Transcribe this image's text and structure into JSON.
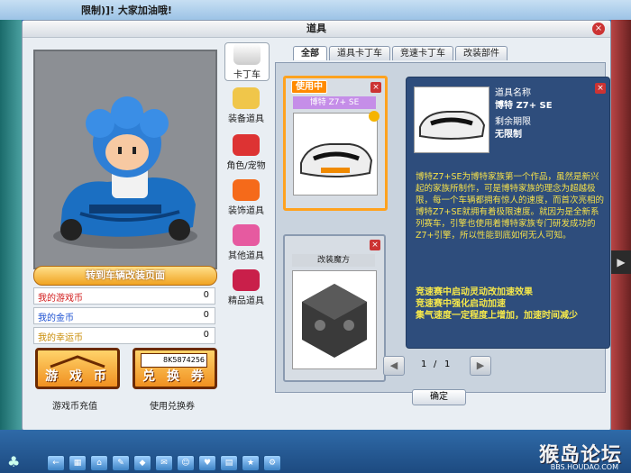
{
  "top_marquee": "限制)]! 大家加油哦!",
  "dialog": {
    "title": "道具",
    "close_label": "×"
  },
  "left_panel": {
    "switch_label": "转到车辆改装页面",
    "currencies": [
      {
        "label": "我的游戏币",
        "value": "0",
        "color": "#d11a1a"
      },
      {
        "label": "我的金币",
        "value": "0",
        "color": "#1a4fd1"
      },
      {
        "label": "我的幸运币",
        "value": "0",
        "color": "#c88a00"
      }
    ],
    "buttons": [
      {
        "label": "游 戏 币",
        "caption": "游戏币充值"
      },
      {
        "label": "兑 换 券",
        "caption": "使用兑换券",
        "barcode": "8K5874256"
      }
    ]
  },
  "categories": [
    {
      "label": "卡丁车",
      "selected": true
    },
    {
      "label": "装备道具",
      "selected": false
    },
    {
      "label": "角色/宠物",
      "selected": false
    },
    {
      "label": "装饰道具",
      "selected": false
    },
    {
      "label": "其他道具",
      "selected": false
    },
    {
      "label": "精品道具",
      "selected": false
    }
  ],
  "tabs": [
    {
      "label": "全部",
      "active": true
    },
    {
      "label": "道具卡丁车",
      "active": false
    },
    {
      "label": "竞速卡丁车",
      "active": false
    },
    {
      "label": "改装部件",
      "active": false
    }
  ],
  "items": [
    {
      "name": "博特 Z7+ SE",
      "badge": "使用中",
      "close": "×"
    },
    {
      "name": "改装魔方",
      "close": "×"
    }
  ],
  "detail": {
    "name_label": "道具名称",
    "name_value": "博特 Z7+ SE",
    "expire_label": "剩余期限",
    "expire_value": "无限制",
    "close": "×",
    "description": "博特Z7+SE为博特家族第一个作品，虽然是新兴起的家族所制作，可是博特家族的理念为超越极限，每一个车辆都拥有惊人的速度，而首次亮相的博特Z7+SE就拥有着极限速度。就因为是全新系列赛车，引擎也使用着博特家族专门研发成功的Z7+引擎，所以性能到底如何无人可知。",
    "features": [
      "竞速赛中启动灵动改加速效果",
      "竞速赛中强化启动加速",
      "集气速度一定程度上增加，加速时间减少"
    ]
  },
  "pager": {
    "prev": "◀",
    "current": "1",
    "sep": "/",
    "total": "1",
    "next": "▶"
  },
  "confirm_label": "确定",
  "watermark": {
    "text": "猴岛论坛",
    "url": "BBS.HOUDAO.COM"
  },
  "side_arrow": "▶"
}
